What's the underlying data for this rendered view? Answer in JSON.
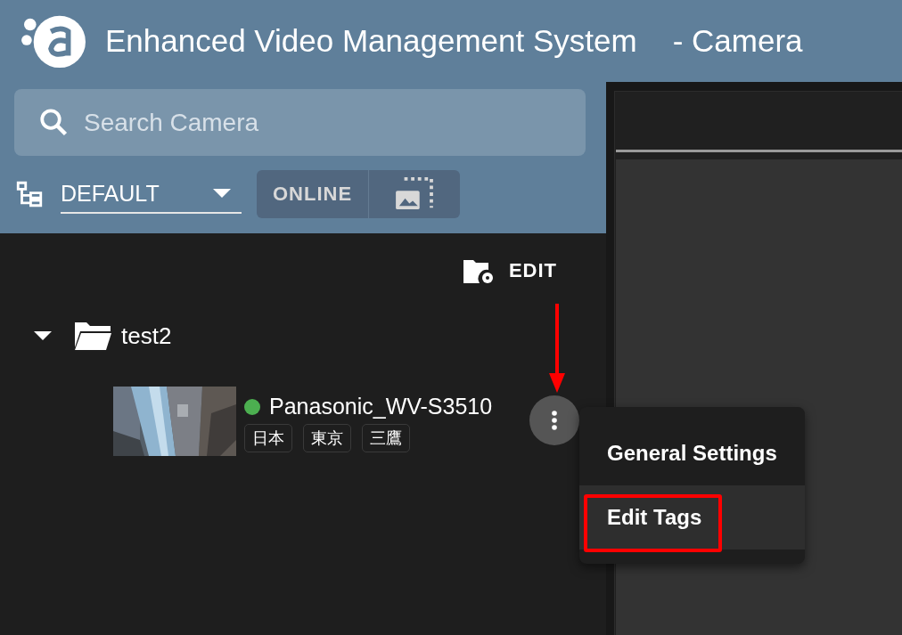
{
  "app": {
    "title": "Enhanced Video Management System",
    "subtitle": "- Camera"
  },
  "search": {
    "placeholder": "Search Camera"
  },
  "view_select": {
    "value": "DEFAULT"
  },
  "filter": {
    "label": "ONLINE"
  },
  "edit": {
    "label": "EDIT"
  },
  "tree": [
    {
      "label": "test2",
      "expanded": true,
      "children": [
        {
          "name": "Panasonic_WV-S3510",
          "online": true,
          "tags": [
            "日本",
            "東京",
            "三鷹"
          ]
        }
      ]
    }
  ],
  "context_menu": {
    "items": [
      {
        "label": "General Settings",
        "selected": false
      },
      {
        "label": "Edit Tags",
        "selected": true
      }
    ]
  }
}
